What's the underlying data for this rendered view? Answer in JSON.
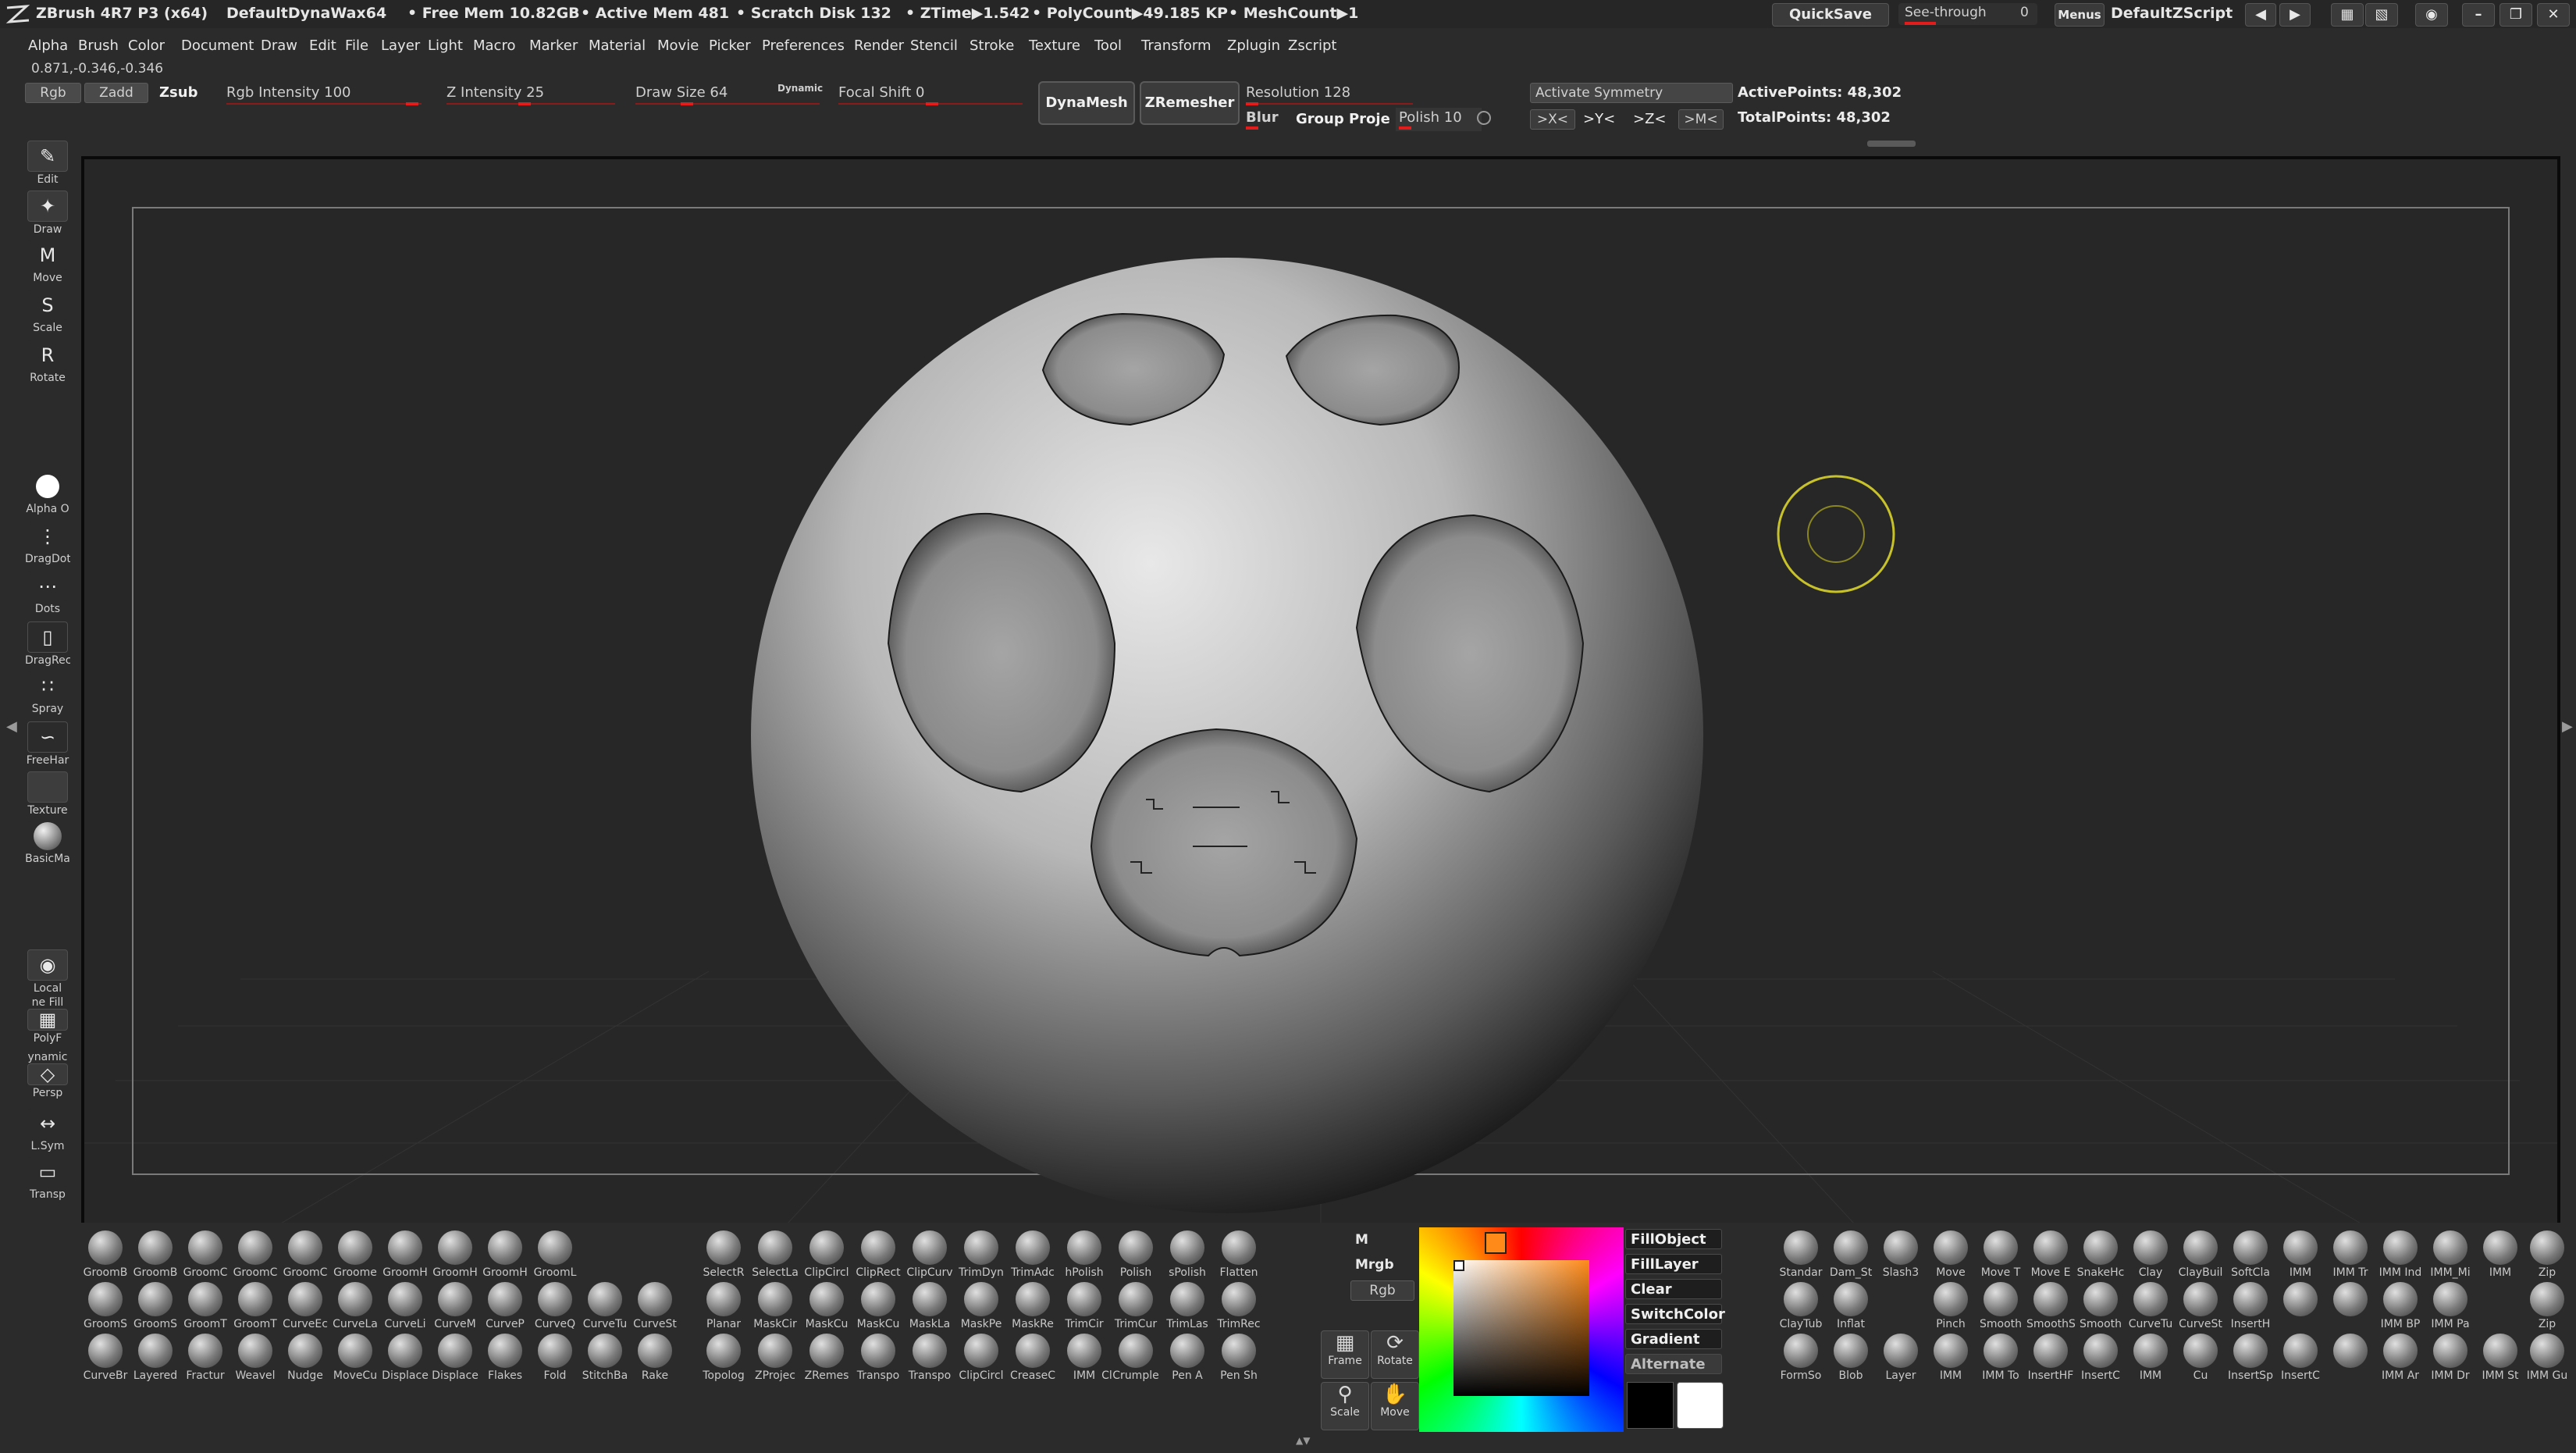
{
  "title_bar": {
    "app_title": "ZBrush 4R7 P3 (x64)",
    "document_name": "DefaultDynaWax64",
    "free_mem": "• Free Mem 10.82GB",
    "active_mem": "• Active Mem 481",
    "scratch_disk": "• Scratch Disk 132",
    "ztime": "• ZTime▶1.542",
    "polycount": "• PolyCount▶49.185 KP",
    "meshcount": "• MeshCount▶1",
    "quicksave_label": "QuickSave",
    "see_through_label": "See-through",
    "see_through_value": "0",
    "menus_label": "Menus",
    "script_label": "DefaultZScript"
  },
  "menubar": {
    "items": [
      "Alpha",
      "Brush",
      "Color",
      "Document",
      "Draw",
      "Edit",
      "File",
      "Layer",
      "Light",
      "Macro",
      "Marker",
      "Material",
      "Movie",
      "Picker",
      "Preferences",
      "Render",
      "Stencil",
      "Stroke",
      "Texture",
      "Tool",
      "Transform",
      "Zplugin",
      "Zscript"
    ]
  },
  "shelf": {
    "coordinates": "0.871,-0.346,-0.346",
    "rgb_label": "Rgb",
    "zadd_label": "Zadd",
    "zsub_label": "Zsub",
    "rgb_intensity": "Rgb Intensity 100",
    "z_intensity": "Z Intensity 25",
    "draw_size": "Draw Size 64",
    "dynamic_label": "Dynamic",
    "focal_shift": "Focal Shift 0",
    "dynamesh_label": "DynaMesh",
    "zremesher_label": "ZRemesher",
    "resolution": "Resolution 128",
    "blur": "Blur",
    "group_projection": "Group Proje",
    "polish": "Polish 10",
    "activate_symmetry": "Activate Symmetry",
    "active_points": "ActivePoints: 48,302",
    "total_points": "TotalPoints: 48,302",
    "sym_x": ">X<",
    "sym_y": ">Y<",
    "sym_z": ">Z<",
    "sym_m": ">M<"
  },
  "left_shelf": {
    "edit": "Edit",
    "draw": "Draw",
    "move": "Move",
    "scale": "Scale",
    "rotate": "Rotate",
    "alpha": "Alpha  O",
    "dragdot": "DragDot",
    "dots": "Dots",
    "dragrect": "DragRec",
    "spray": "Spray",
    "freehand": "FreeHar",
    "texture": "Texture",
    "material": "BasicMa",
    "local": "Local",
    "line_fill": "ne Fill",
    "polyf": "PolyF",
    "dynamic": "ynamic",
    "persp": "Persp",
    "lsym": "L.Sym",
    "transp": "Transp"
  },
  "brushes_left": [
    [
      "GroomB",
      "GroomB",
      "GroomC",
      "GroomC",
      "GroomC",
      "Groome",
      "GroomH",
      "GroomH",
      "GroomH",
      "GroomL"
    ],
    [
      "GroomS",
      "GroomS",
      "GroomT",
      "GroomT",
      "CurveEc",
      "CurveLa",
      "CurveLi",
      "CurveM",
      "CurveP",
      "CurveQ",
      "CurveTu",
      "CurveSt"
    ],
    [
      "CurveBr",
      "Layered",
      "Fractur",
      "Weavel",
      "Nudge",
      "MoveCu",
      "Displace",
      "Displace",
      "Flakes",
      "Fold",
      "StitchBa",
      "Rake"
    ]
  ],
  "brushes_mid": [
    [
      "SelectR",
      "SelectLa",
      "ClipCircl",
      "ClipRect",
      "ClipCurv",
      "TrimDyn",
      "TrimAdc",
      "hPolish",
      "Polish",
      "sPolish",
      "Flatten"
    ],
    [
      "Planar",
      "MaskCir",
      "MaskCu",
      "MaskCu",
      "MaskLa",
      "MaskPe",
      "MaskRe",
      "TrimCir",
      "TrimCur",
      "TrimLas",
      "TrimRec"
    ],
    [
      "Topolog",
      "ZProjec",
      "ZRemes",
      "Transpo",
      "Transpo",
      "ClipCircl",
      "CreaseC",
      "IMM",
      "Cl",
      "Crumple",
      "Pen A",
      "Pen Sh"
    ]
  ],
  "color_panel": {
    "m_label": "M",
    "mrgb_label": "Mrgb",
    "rgb_label": "Rgb",
    "frame_label": "Frame",
    "rotate_label": "Rotate",
    "scale_label": "Scale",
    "move_label": "Move",
    "fill_object": "FillObject",
    "fill_layer": "FillLayer",
    "clear": "Clear",
    "switch_color": "SwitchColor",
    "gradient": "Gradient",
    "alternate": "Alternate"
  },
  "brushes_right": [
    [
      "Standar",
      "Dam_St",
      "Slash3",
      "Move",
      "Move T",
      "Move E",
      "SnakeHc",
      "Clay",
      "ClayBuil",
      "SoftCla",
      "IMM",
      "IMM Tr",
      "IMM Ind",
      "IMM_Mi",
      "IMM",
      "Zip"
    ],
    [
      "ClayTub",
      "Inflat",
      "",
      "Pinch",
      "Smooth",
      "SmoothS",
      "Smooth",
      "CurveTu",
      "CurveSt",
      "InsertH",
      "",
      "",
      "IMM BP",
      "IMM Pa",
      "",
      "Zip"
    ],
    [
      "FormSo",
      "Blob",
      "Layer",
      "IMM",
      "IMM To",
      "InsertHF",
      "InsertC",
      "IMM",
      "Cu",
      "InsertSp",
      "InsertC",
      "",
      "IMM Ar",
      "IMM Dr",
      "IMM St",
      "IMM Gu"
    ]
  ]
}
